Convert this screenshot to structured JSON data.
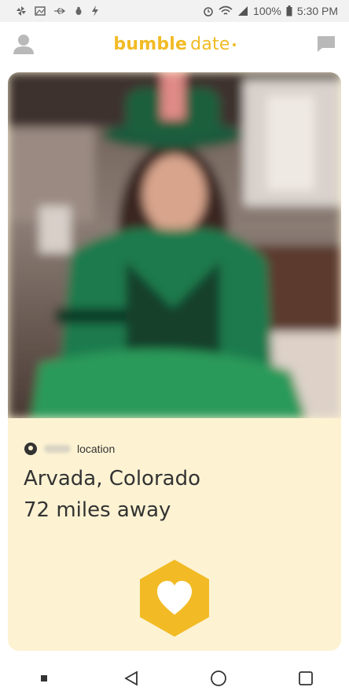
{
  "status_bar": {
    "battery": "100%",
    "time": "5:30 PM",
    "icons": [
      "pinwheel-icon",
      "image-icon",
      "usb-icon",
      "bug-icon",
      "bolt-icon",
      "alarm-icon",
      "wifi-icon",
      "signal-icon",
      "battery-icon"
    ]
  },
  "header": {
    "logo_word1": "bumble",
    "logo_word2": "date",
    "brand_color": "#f2bb25"
  },
  "card": {
    "location_label": "location",
    "city": "Arvada, Colorado",
    "distance": "72 miles away",
    "background_color": "#fdf3d3"
  },
  "nav": {
    "items": [
      "menu-dot-icon",
      "back-icon",
      "home-icon",
      "recents-icon"
    ]
  }
}
